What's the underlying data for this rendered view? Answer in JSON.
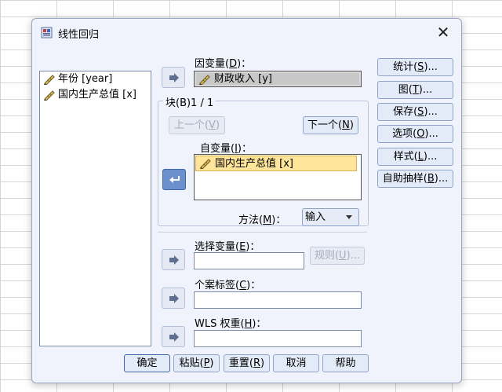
{
  "dialog": {
    "title": "线性回归",
    "close_label": "✕"
  },
  "variables": [
    {
      "label": "年份 [year]",
      "icon": "scale-pencil-icon"
    },
    {
      "label": "国内生产总值 [x]",
      "icon": "scale-pencil-icon"
    }
  ],
  "dependent": {
    "label_pre": "因变量(",
    "label_key": "D",
    "label_post": ")：",
    "value": "财政收入 [y]"
  },
  "block": {
    "legend": "块(B)1 / 1",
    "prev_pre": "上一个(",
    "prev_key": "V",
    "prev_post": ")",
    "next_pre": "下一个(",
    "next_key": "N",
    "next_post": ")",
    "independent_label_pre": "自变量(",
    "independent_label_key": "I",
    "independent_label_post": ")：",
    "independent_items": [
      "国内生产总值 [x]"
    ],
    "method_label_pre": "方法(",
    "method_label_key": "M",
    "method_label_post": ")：",
    "method_value": "输入"
  },
  "selection": {
    "label_pre": "选择变量(",
    "label_key": "E",
    "label_post": ")：",
    "value": "",
    "rule_pre": "规则(",
    "rule_key": "U",
    "rule_post": ")..."
  },
  "case_label": {
    "label_pre": "个案标签(",
    "label_key": "C",
    "label_post": ")：",
    "value": ""
  },
  "wls": {
    "label_pre": "WLS 权重(",
    "label_key": "H",
    "label_post": ")：",
    "value": ""
  },
  "side_buttons": [
    {
      "pre": "统计(",
      "key": "S",
      "post": ")..."
    },
    {
      "pre": "图(",
      "key": "T",
      "post": ")..."
    },
    {
      "pre": "保存(",
      "key": "S",
      "post": ")..."
    },
    {
      "pre": "选项(",
      "key": "O",
      "post": ")..."
    },
    {
      "pre": "样式(",
      "key": "L",
      "post": ")..."
    },
    {
      "pre": "自助抽样(",
      "key": "B",
      "post": ")..."
    }
  ],
  "bottom_buttons": {
    "ok": {
      "pre": "确定",
      "key": "",
      "post": ""
    },
    "paste": {
      "pre": "粘贴(",
      "key": "P",
      "post": ")"
    },
    "reset": {
      "pre": "重置(",
      "key": "R",
      "post": ")"
    },
    "cancel": {
      "pre": "取消",
      "key": "",
      "post": ""
    },
    "help": {
      "pre": "帮助",
      "key": "",
      "post": ""
    }
  },
  "colors": {
    "dialog_bg": "#f0f3fb",
    "button_bg": "#e3ebf8",
    "selected_item": "#ffe59a",
    "active_arrow": "#6b90cc"
  }
}
